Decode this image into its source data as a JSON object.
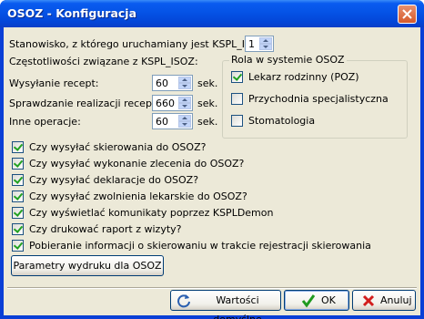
{
  "window": {
    "title": "OSOZ - Konfiguracja"
  },
  "station": {
    "label": "Stanowisko, z którego uruchamiany jest KSPL_ISOZ:",
    "value": "1"
  },
  "freq": {
    "heading": "Częstotliwości związane z KSPL_ISOZ:",
    "unit": "sek.",
    "rows": [
      {
        "label": "Wysyłanie recept:",
        "value": "60"
      },
      {
        "label": "Sprawdzanie realizacji recept:",
        "value": "660"
      },
      {
        "label": "Inne operacje:",
        "value": "60"
      }
    ]
  },
  "role": {
    "title": "Rola w systemie OSOZ",
    "items": [
      {
        "label": "Lekarz rodzinny (POZ)",
        "checked": true
      },
      {
        "label": "Przychodnia specjalistyczna",
        "checked": false
      },
      {
        "label": "Stomatologia",
        "checked": false
      }
    ]
  },
  "options": [
    {
      "label": "Czy wysyłać skierowania do OSOZ?",
      "checked": true
    },
    {
      "label": "Czy wysyłać wykonanie zlecenia do OSOZ?",
      "checked": true
    },
    {
      "label": "Czy wysyłać deklaracje do OSOZ?",
      "checked": true
    },
    {
      "label": "Czy wysyłać zwolnienia lekarskie do OSOZ?",
      "checked": true
    },
    {
      "label": "Czy wyświetlać komunikaty poprzez KSPLDemon",
      "checked": true
    },
    {
      "label": "Czy drukować raport z wizyty?",
      "checked": true
    },
    {
      "label": "Pobieranie informacji o skierowaniu w trakcie rejestracji skierowania",
      "checked": true
    }
  ],
  "buttons": {
    "print_params": "Parametry wydruku dla OSOZ",
    "defaults": "Wartości domyślne",
    "ok": "OK",
    "cancel": "Anuluj"
  },
  "icons": {
    "close": "close-icon",
    "defaults": "refresh-icon",
    "ok": "checkmark-icon",
    "cancel": "x-icon"
  }
}
